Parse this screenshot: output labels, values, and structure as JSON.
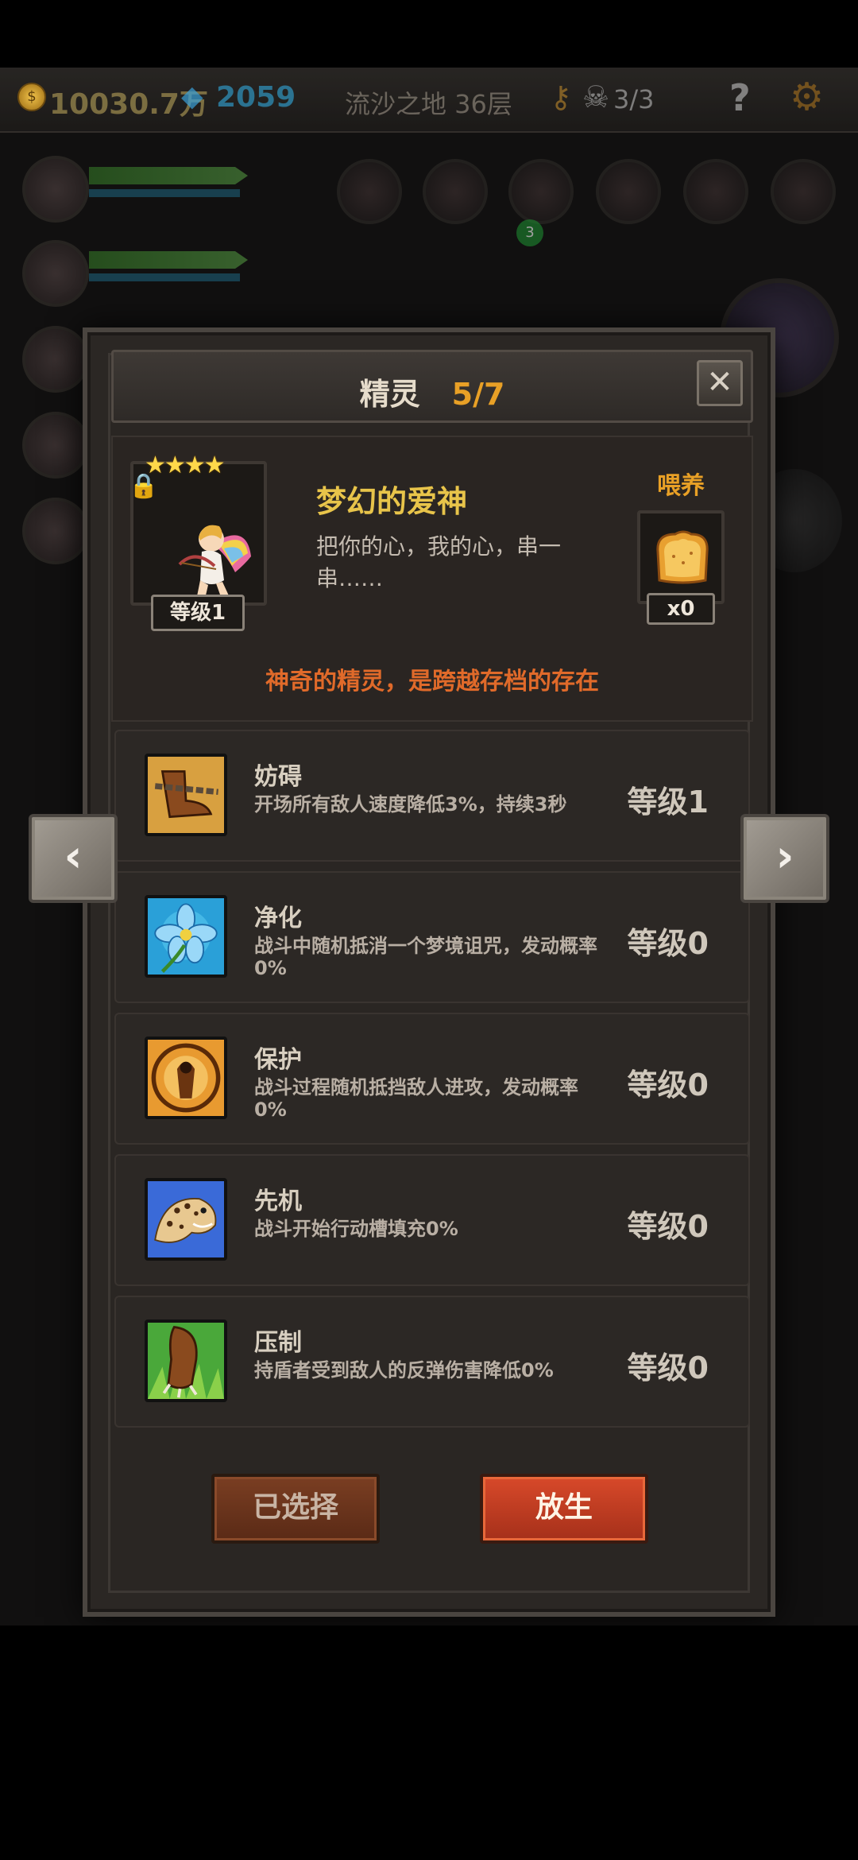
{
  "hud": {
    "gold": "10030.7万",
    "gems": "2059",
    "stage": "流沙之地 36层",
    "skull_count": "3/3",
    "help": "?",
    "coin_glyph": "$",
    "badge": "3"
  },
  "modal": {
    "title": "精灵",
    "count": "5/7",
    "close": "✕",
    "spirit": {
      "stars": "★★★★",
      "level": "等级1",
      "name_part1": "梦幻的",
      "name_part2": "爱神",
      "description": "把你的心，我的心，串一串……",
      "feed_label": "喂养",
      "feed_count": "x0",
      "tagline": "神奇的精灵，是跨越存档的存在"
    },
    "skills": [
      {
        "icon": "chained-boot-icon",
        "name": "妨碍",
        "desc": "开场所有敌人速度降低3%，持续3秒",
        "level": "等级1"
      },
      {
        "icon": "blue-flower-icon",
        "name": "净化",
        "desc": "战斗中随机抵消一个梦境诅咒，发动概率0%",
        "level": "等级0"
      },
      {
        "icon": "fairy-shield-icon",
        "name": "保护",
        "desc": "战斗过程随机抵挡敌人进攻，发动概率0%",
        "level": "等级0"
      },
      {
        "icon": "leopard-icon",
        "name": "先机",
        "desc": "战斗开始行动槽填充0%",
        "level": "等级0"
      },
      {
        "icon": "claw-icon",
        "name": "压制",
        "desc": "持盾者受到敌人的反弹伤害降低0%",
        "level": "等级0"
      }
    ],
    "buttons": {
      "selected": "已选择",
      "release": "放生"
    }
  },
  "nav": {
    "prev": "‹",
    "next": "›"
  },
  "colors": {
    "accent_orange": "#e8a026",
    "name_gold": "#e8c44a",
    "tagline": "#e06a2a",
    "release_button": "#d8492a"
  }
}
